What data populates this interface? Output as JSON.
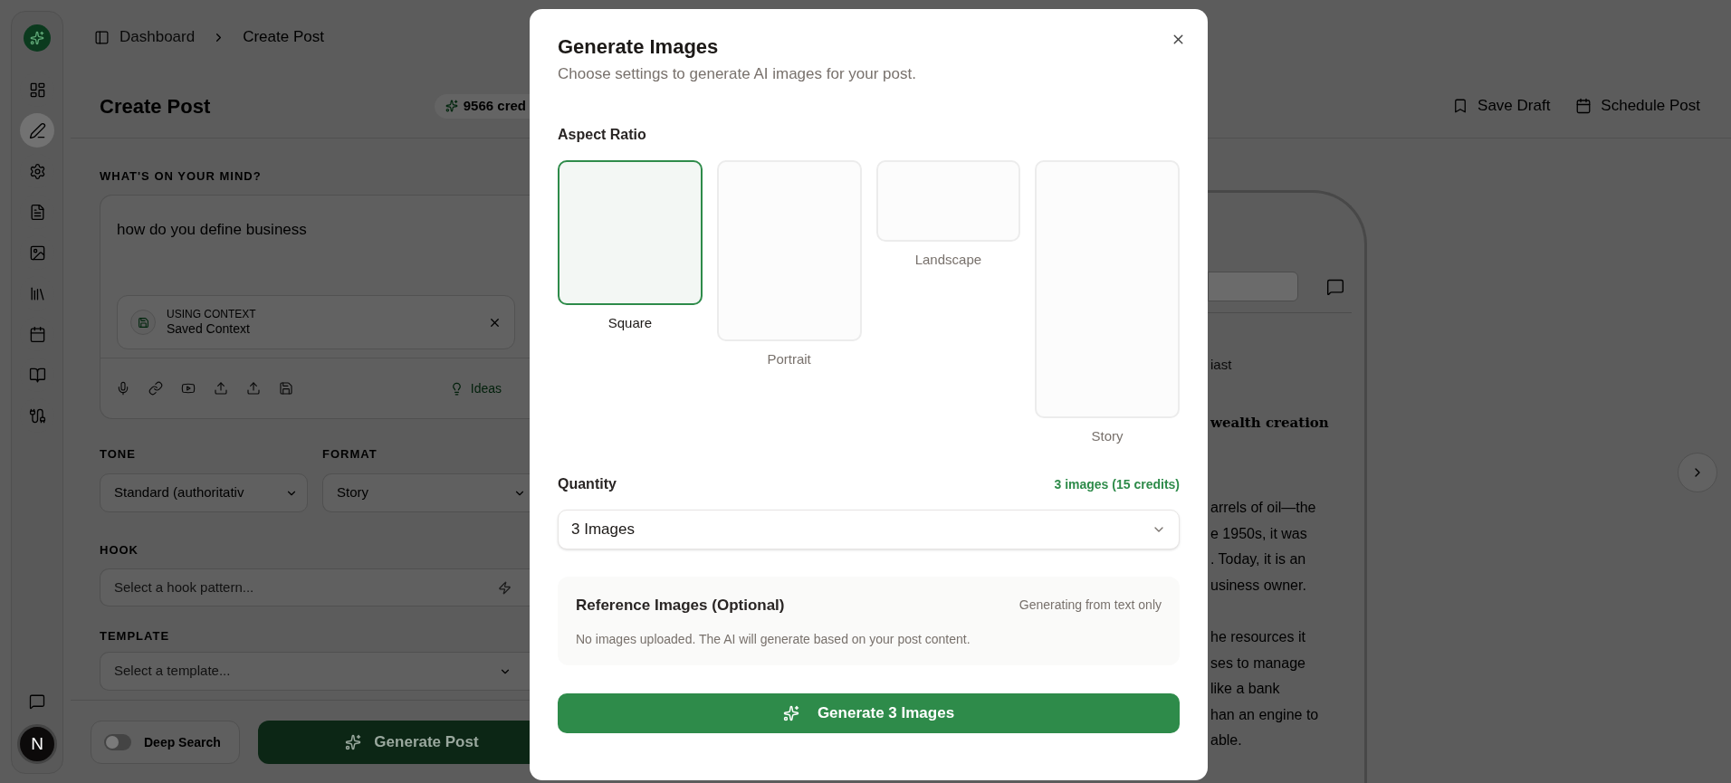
{
  "nav_items": [
    {
      "kind": "dashboard",
      "selected": false
    },
    {
      "kind": "pencil",
      "selected": true
    },
    {
      "kind": "gear",
      "selected": false
    },
    {
      "kind": "document",
      "selected": false
    },
    {
      "kind": "image",
      "selected": false
    },
    {
      "kind": "library",
      "selected": false
    },
    {
      "kind": "calendar",
      "selected": false
    },
    {
      "kind": "book",
      "selected": false
    },
    {
      "kind": "cable",
      "selected": false
    }
  ],
  "avatar": {
    "initial": "N"
  },
  "breadcrumb": [
    "Dashboard",
    "Create Post"
  ],
  "page_title": "Create Post",
  "credits": "9566 cred",
  "actions": [
    {
      "kind": "bookmark",
      "label": "Save Draft"
    },
    {
      "kind": "calendar",
      "label": "Schedule Post"
    }
  ],
  "prompt": {
    "label": "WHAT'S ON YOUR MIND?",
    "value": "how do you define business",
    "context": {
      "caption": "USING CONTEXT",
      "name": "Saved Context"
    },
    "ideas": "Ideas"
  },
  "tone": {
    "label": "TONE",
    "value": "Standard (authoritativ"
  },
  "format": {
    "label": "FORMAT",
    "value": "Story"
  },
  "hook": {
    "label": "HOOK",
    "placeholder": "Select a hook pattern..."
  },
  "template": {
    "label": "TEMPLATE",
    "placeholder": "Select a template..."
  },
  "deep_search": {
    "label": "Deep Search",
    "on": false
  },
  "generate_post": "Generate Post",
  "preview": [
    {
      "kind": "meta",
      "lines": [
        "iast"
      ]
    },
    {
      "kind": "heading",
      "lines": [
        "wealth creation"
      ]
    },
    {
      "kind": "paragraph",
      "lines": [
        "arrels of oil—the",
        "e 1950s, it was",
        ". Today, it is an",
        "usiness owner."
      ]
    },
    {
      "kind": "paragraph",
      "lines": [
        "he resources it",
        "ses to manage",
        "like a bank",
        "han an engine to",
        "able."
      ]
    }
  ],
  "dialog": {
    "title": "Generate Images",
    "subtitle": "Choose settings to generate AI images for your post.",
    "aspect_label": "Aspect Ratio",
    "aspects": [
      {
        "kind": "square",
        "label": "Square",
        "selected": true
      },
      {
        "kind": "portrait",
        "label": "Portrait",
        "selected": false
      },
      {
        "kind": "landscape",
        "label": "Landscape",
        "selected": false
      },
      {
        "kind": "story",
        "label": "Story",
        "selected": false
      }
    ],
    "quantity": {
      "label": "Quantity",
      "summary": "3 images (15 credits)",
      "value": "3 Images"
    },
    "reference": {
      "title": "Reference Images (Optional)",
      "status": "Generating from text only",
      "note": "No images uploaded. The AI will generate based on your post content."
    },
    "submit": "Generate 3 Images"
  }
}
